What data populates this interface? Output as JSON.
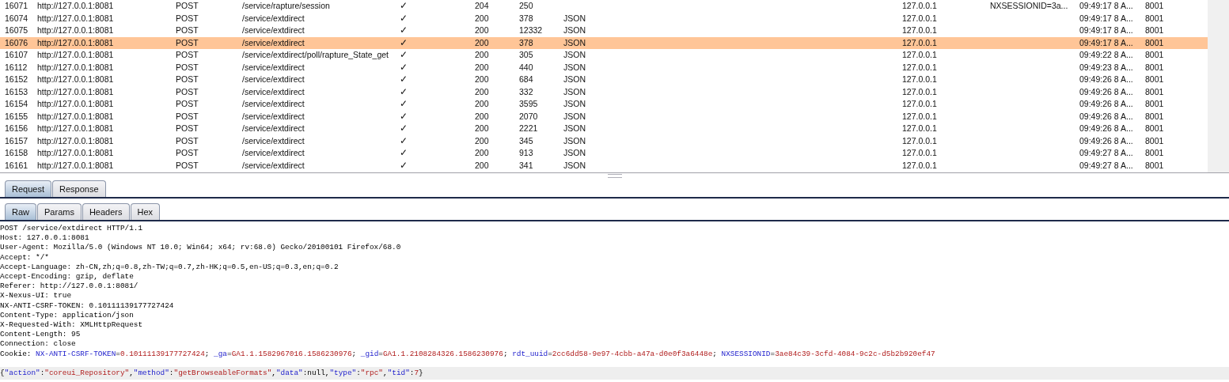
{
  "table": {
    "rows": [
      {
        "selected": false,
        "column_1": "16071",
        "column_2": "http://127.0.0.1:8081",
        "column_3": "POST",
        "column_4": "/service/rapture/session",
        "column_5": "✓",
        "column_6": "204",
        "column_7": "250",
        "column_9": "127.0.0.1",
        "column_10": "NXSESSIONID=3a...",
        "column_11": "09:49:17 8 A...",
        "column_12": "8001"
      },
      {
        "selected": false,
        "column_1": "16074",
        "column_2": "http://127.0.0.1:8081",
        "column_3": "POST",
        "column_4": "/service/extdirect",
        "column_5": "✓",
        "column_6": "200",
        "column_7": "378",
        "column_8": "JSON",
        "column_9": "127.0.0.1",
        "column_11": "09:49:17 8 A...",
        "column_12": "8001"
      },
      {
        "selected": false,
        "column_1": "16075",
        "column_2": "http://127.0.0.1:8081",
        "column_3": "POST",
        "column_4": "/service/extdirect",
        "column_5": "✓",
        "column_6": "200",
        "column_7": "12332",
        "column_8": "JSON",
        "column_9": "127.0.0.1",
        "column_11": "09:49:17 8 A...",
        "column_12": "8001"
      },
      {
        "selected": true,
        "column_1": "16076",
        "column_2": "http://127.0.0.1:8081",
        "column_3": "POST",
        "column_4": "/service/extdirect",
        "column_5": "✓",
        "column_6": "200",
        "column_7": "378",
        "column_8": "JSON",
        "column_9": "127.0.0.1",
        "column_11": "09:49:17 8 A...",
        "column_12": "8001"
      },
      {
        "selected": false,
        "column_1": "16107",
        "column_2": "http://127.0.0.1:8081",
        "column_3": "POST",
        "column_4": "/service/extdirect/poll/rapture_State_get",
        "column_5": "✓",
        "column_6": "200",
        "column_7": "305",
        "column_8": "JSON",
        "column_9": "127.0.0.1",
        "column_11": "09:49:22 8 A...",
        "column_12": "8001"
      },
      {
        "selected": false,
        "column_1": "16112",
        "column_2": "http://127.0.0.1:8081",
        "column_3": "POST",
        "column_4": "/service/extdirect",
        "column_5": "✓",
        "column_6": "200",
        "column_7": "440",
        "column_8": "JSON",
        "column_9": "127.0.0.1",
        "column_11": "09:49:23 8 A...",
        "column_12": "8001"
      },
      {
        "selected": false,
        "column_1": "16152",
        "column_2": "http://127.0.0.1:8081",
        "column_3": "POST",
        "column_4": "/service/extdirect",
        "column_5": "✓",
        "column_6": "200",
        "column_7": "684",
        "column_8": "JSON",
        "column_9": "127.0.0.1",
        "column_11": "09:49:26 8 A...",
        "column_12": "8001"
      },
      {
        "selected": false,
        "column_1": "16153",
        "column_2": "http://127.0.0.1:8081",
        "column_3": "POST",
        "column_4": "/service/extdirect",
        "column_5": "✓",
        "column_6": "200",
        "column_7": "332",
        "column_8": "JSON",
        "column_9": "127.0.0.1",
        "column_11": "09:49:26 8 A...",
        "column_12": "8001"
      },
      {
        "selected": false,
        "column_1": "16154",
        "column_2": "http://127.0.0.1:8081",
        "column_3": "POST",
        "column_4": "/service/extdirect",
        "column_5": "✓",
        "column_6": "200",
        "column_7": "3595",
        "column_8": "JSON",
        "column_9": "127.0.0.1",
        "column_11": "09:49:26 8 A...",
        "column_12": "8001"
      },
      {
        "selected": false,
        "column_1": "16155",
        "column_2": "http://127.0.0.1:8081",
        "column_3": "POST",
        "column_4": "/service/extdirect",
        "column_5": "✓",
        "column_6": "200",
        "column_7": "2070",
        "column_8": "JSON",
        "column_9": "127.0.0.1",
        "column_11": "09:49:26 8 A...",
        "column_12": "8001"
      },
      {
        "selected": false,
        "column_1": "16156",
        "column_2": "http://127.0.0.1:8081",
        "column_3": "POST",
        "column_4": "/service/extdirect",
        "column_5": "✓",
        "column_6": "200",
        "column_7": "2221",
        "column_8": "JSON",
        "column_9": "127.0.0.1",
        "column_11": "09:49:26 8 A...",
        "column_12": "8001"
      },
      {
        "selected": false,
        "column_1": "16157",
        "column_2": "http://127.0.0.1:8081",
        "column_3": "POST",
        "column_4": "/service/extdirect",
        "column_5": "✓",
        "column_6": "200",
        "column_7": "345",
        "column_8": "JSON",
        "column_9": "127.0.0.1",
        "column_11": "09:49:26 8 A...",
        "column_12": "8001"
      },
      {
        "selected": false,
        "column_1": "16158",
        "column_2": "http://127.0.0.1:8081",
        "column_3": "POST",
        "column_4": "/service/extdirect",
        "column_5": "✓",
        "column_6": "200",
        "column_7": "913",
        "column_8": "JSON",
        "column_9": "127.0.0.1",
        "column_11": "09:49:27 8 A...",
        "column_12": "8001"
      },
      {
        "selected": false,
        "column_1": "16161",
        "column_2": "http://127.0.0.1:8081",
        "column_3": "POST",
        "column_4": "/service/extdirect",
        "column_5": "✓",
        "column_6": "200",
        "column_7": "341",
        "column_8": "JSON",
        "column_9": "127.0.0.1",
        "column_11": "09:49:27 8 A...",
        "column_12": "8001"
      }
    ]
  },
  "tabs": [
    {
      "label": "Request",
      "selected": true
    },
    {
      "label": "Response",
      "selected": false
    }
  ],
  "subtabs": [
    {
      "label": "Raw",
      "selected": true
    },
    {
      "label": "Params",
      "selected": false
    },
    {
      "label": "Headers",
      "selected": false
    },
    {
      "label": "Hex",
      "selected": false
    }
  ],
  "raw": {
    "lines": [
      "POST /service/extdirect HTTP/1.1",
      "Host: 127.0.0.1:8081",
      "User-Agent: Mozilla/5.0 (Windows NT 10.0; Win64; x64; rv:68.0) Gecko/20100101 Firefox/68.0",
      "Accept: */*",
      "Accept-Language: zh-CN,zh;q=0.8,zh-TW;q=0.7,zh-HK;q=0.5,en-US;q=0.3,en;q=0.2",
      "Accept-Encoding: gzip, deflate",
      "Referer: http://127.0.0.1:8081/",
      "X-Nexus-UI: true",
      "NX-ANTI-CSRF-TOKEN: 0.10111139177727424",
      "Content-Type: application/json",
      "X-Requested-With: XMLHttpRequest",
      "Content-Length: 95",
      "Connection: close"
    ],
    "cookie_line": [
      {
        "text": "Cookie: ",
        "kind": "plain"
      },
      {
        "text": "NX-ANTI-CSRF-TOKEN",
        "kind": "key"
      },
      {
        "text": "=",
        "kind": "plain"
      },
      {
        "text": "0.10111139177727424",
        "kind": "value"
      },
      {
        "text": "; ",
        "kind": "plain"
      },
      {
        "text": "_ga",
        "kind": "key"
      },
      {
        "text": "=",
        "kind": "plain"
      },
      {
        "text": "GA1.1.1582967016.1586230976",
        "kind": "value"
      },
      {
        "text": "; ",
        "kind": "plain"
      },
      {
        "text": "_gid",
        "kind": "key"
      },
      {
        "text": "=",
        "kind": "plain"
      },
      {
        "text": "GA1.1.2108284326.1586230976",
        "kind": "value"
      },
      {
        "text": "; ",
        "kind": "plain"
      },
      {
        "text": "rdt_uuid",
        "kind": "key"
      },
      {
        "text": "=",
        "kind": "plain"
      },
      {
        "text": "2cc6dd58-9e97-4cbb-a47a-d0e0f3a6448e",
        "kind": "value"
      },
      {
        "text": "; ",
        "kind": "plain"
      },
      {
        "text": "NXSESSIONID",
        "kind": "key"
      },
      {
        "text": "=",
        "kind": "plain"
      },
      {
        "text": "3ae84c39-3cfd-4084-9c2c-d5b2b920ef47",
        "kind": "value"
      }
    ],
    "body_line": [
      {
        "text": "{",
        "kind": "plain"
      },
      {
        "text": "\"action\"",
        "kind": "key"
      },
      {
        "text": ":",
        "kind": "plain"
      },
      {
        "text": "\"coreui_Repository\"",
        "kind": "value"
      },
      {
        "text": ",",
        "kind": "plain"
      },
      {
        "text": "\"method\"",
        "kind": "key"
      },
      {
        "text": ":",
        "kind": "plain"
      },
      {
        "text": "\"getBrowseableFormats\"",
        "kind": "value"
      },
      {
        "text": ",",
        "kind": "plain"
      },
      {
        "text": "\"data\"",
        "kind": "key"
      },
      {
        "text": ":null,",
        "kind": "plain"
      },
      {
        "text": "\"type\"",
        "kind": "key"
      },
      {
        "text": ":",
        "kind": "plain"
      },
      {
        "text": "\"rpc\"",
        "kind": "value"
      },
      {
        "text": ",",
        "kind": "plain"
      },
      {
        "text": "\"tid\"",
        "kind": "key"
      },
      {
        "text": ":",
        "kind": "plain"
      },
      {
        "text": "7",
        "kind": "value"
      },
      {
        "text": "}",
        "kind": "plain"
      }
    ]
  }
}
